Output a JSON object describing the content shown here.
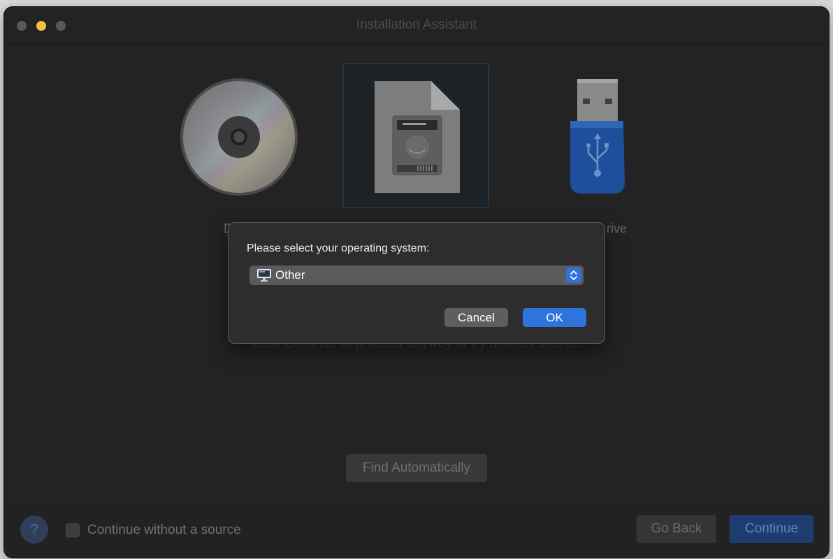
{
  "window": {
    "title": "Installation Assistant"
  },
  "sources": {
    "dvd_label_fragment": "D",
    "usb_label_fragment": "rive",
    "info_text": "Click Continue to proceed anyway or try another source."
  },
  "main": {
    "find_button": "Find Automatically"
  },
  "footer": {
    "help_label": "?",
    "checkbox_label": "Continue without a source",
    "checkbox_checked": false,
    "go_back_label": "Go Back",
    "continue_label": "Continue"
  },
  "dialog": {
    "prompt": "Please select your operating system:",
    "os_select_value": "Other",
    "os_select_icon": "monitor-icon",
    "cancel_label": "Cancel",
    "ok_label": "OK"
  },
  "colors": {
    "accent": "#2f73dc",
    "window_bg": "#232323",
    "minimize_dot": "#f6bf3b"
  }
}
